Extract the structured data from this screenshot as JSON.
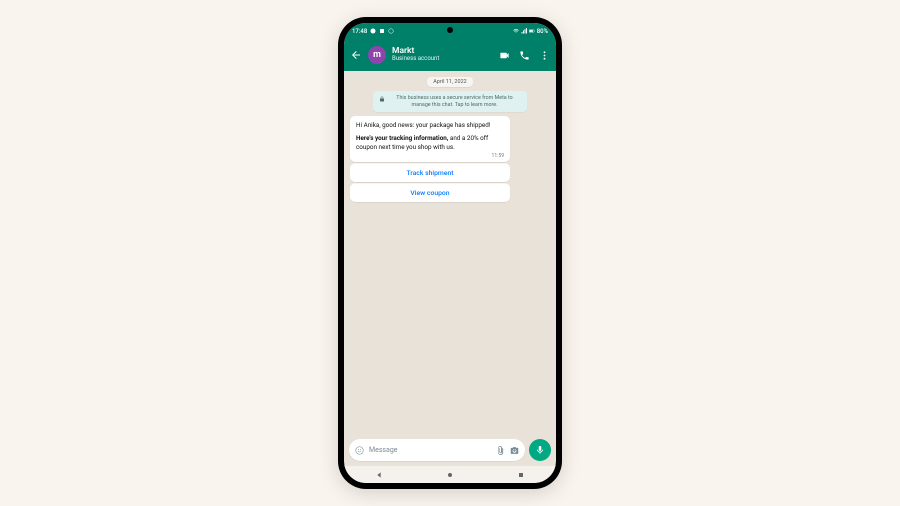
{
  "status": {
    "time": "17:48",
    "battery": "80%"
  },
  "header": {
    "contact_name": "Markt",
    "contact_subtitle": "Business account",
    "avatar_letter": "m"
  },
  "chat": {
    "date": "April 11, 2022",
    "secure_notice": "This business uses a secure service from Meta to manage this chat. Tap to learn more.",
    "message": {
      "line1": "Hi Anika, good news: your package has shipped!",
      "line2_bold": "Here's your tracking information,",
      "line2_rest": " and a 20% off coupon next time you shop with us.",
      "time": "11:59"
    },
    "buttons": {
      "track": "Track shipment",
      "coupon": "View coupon"
    }
  },
  "input": {
    "placeholder": "Message"
  },
  "colors": {
    "brand": "#008069",
    "link": "#0a7cff",
    "mic": "#00a884"
  }
}
